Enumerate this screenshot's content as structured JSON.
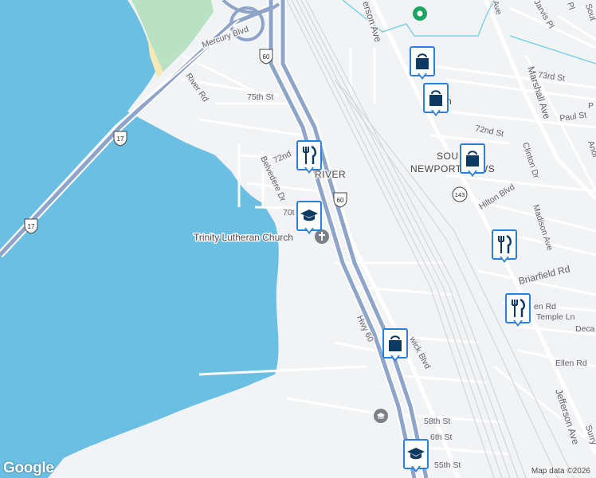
{
  "map": {
    "water_color": "#6bbfe3",
    "land_color": "#f1f3f4",
    "highway_color": "#8ea4c8",
    "park_color": "#b9e1c4",
    "road_labels": {
      "mercury_blvd": "Mercury Blvd",
      "river_rd": "River Rd",
      "st_75th": "75th St",
      "st_72nd_w": "72nd",
      "belvedere_dr": "Belvedere Dr",
      "st_70th": "70t",
      "hwy_60": "Hwy 60",
      "warwick_blvd": "wick Blvd",
      "st_58th": "58th St",
      "st_56th": "6th St",
      "st_55th": "55th St",
      "st_73rd": "73rd St",
      "paul_st": "Paul St",
      "p_st": "P",
      "st_72nd_e": "72nd St",
      "clinton_dr": "Clinton Dr",
      "hilton_blvd": "Hilton Blvd",
      "madison_ave": "Madison Ave",
      "briarfield_rd": "Briarfield Rd",
      "en_rd": "en Rd",
      "temple_ln": "Temple Ln",
      "deca": "Deca",
      "ellen_rd": "Ellen Rd",
      "marshall_ave": "Marshall Ave",
      "jefferson_ave_s": "Jefferson Ave",
      "jefferson_ave_n": "erson Ave",
      "surry": "Surry",
      "andr": "Andr",
      "sout": "Sout",
      "jarvis_pl": "Jarvis Pl",
      "pl": "Pl",
      "ave_n": "Ave"
    },
    "shields": [
      {
        "id": "us60_top",
        "num": "60"
      },
      {
        "id": "us60_mid",
        "num": "60"
      },
      {
        "id": "us17_a",
        "num": "17"
      },
      {
        "id": "us17_b",
        "num": "17"
      },
      {
        "id": "va143",
        "num": "143"
      }
    ],
    "place_labels": {
      "church": "Trinity Lutheran Church",
      "area_line1": "SOU",
      "area_line2": "NEWPORT NEWS",
      "river": "RIVER",
      "marker_overlap": "n"
    },
    "markers": [
      {
        "id": "shop-1",
        "icon": "shopping-bag-icon"
      },
      {
        "id": "shop-2",
        "icon": "shopping-bag-icon"
      },
      {
        "id": "food-1",
        "icon": "restaurant-icon"
      },
      {
        "id": "shop-3",
        "icon": "shopping-bag-icon"
      },
      {
        "id": "school-1",
        "icon": "school-icon"
      },
      {
        "id": "food-2",
        "icon": "restaurant-icon"
      },
      {
        "id": "food-3",
        "icon": "restaurant-icon"
      },
      {
        "id": "shop-4",
        "icon": "shopping-bag-icon"
      },
      {
        "id": "school-2",
        "icon": "school-icon"
      }
    ]
  },
  "footer": {
    "logo": "Google",
    "attribution": "Map data ©2026"
  }
}
